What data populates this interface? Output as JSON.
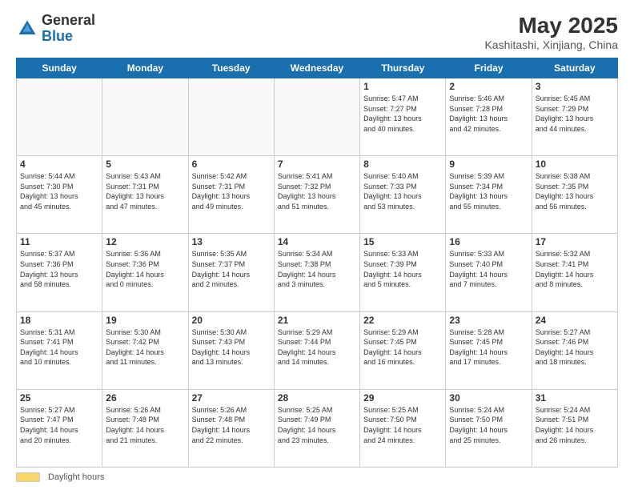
{
  "header": {
    "logo_general": "General",
    "logo_blue": "Blue",
    "month_title": "May 2025",
    "location": "Kashitashi, Xinjiang, China"
  },
  "footer": {
    "label": "Daylight hours"
  },
  "days_of_week": [
    "Sunday",
    "Monday",
    "Tuesday",
    "Wednesday",
    "Thursday",
    "Friday",
    "Saturday"
  ],
  "weeks": [
    [
      {
        "day": "",
        "info": ""
      },
      {
        "day": "",
        "info": ""
      },
      {
        "day": "",
        "info": ""
      },
      {
        "day": "",
        "info": ""
      },
      {
        "day": "1",
        "info": "Sunrise: 5:47 AM\nSunset: 7:27 PM\nDaylight: 13 hours\nand 40 minutes."
      },
      {
        "day": "2",
        "info": "Sunrise: 5:46 AM\nSunset: 7:28 PM\nDaylight: 13 hours\nand 42 minutes."
      },
      {
        "day": "3",
        "info": "Sunrise: 5:45 AM\nSunset: 7:29 PM\nDaylight: 13 hours\nand 44 minutes."
      }
    ],
    [
      {
        "day": "4",
        "info": "Sunrise: 5:44 AM\nSunset: 7:30 PM\nDaylight: 13 hours\nand 45 minutes."
      },
      {
        "day": "5",
        "info": "Sunrise: 5:43 AM\nSunset: 7:31 PM\nDaylight: 13 hours\nand 47 minutes."
      },
      {
        "day": "6",
        "info": "Sunrise: 5:42 AM\nSunset: 7:31 PM\nDaylight: 13 hours\nand 49 minutes."
      },
      {
        "day": "7",
        "info": "Sunrise: 5:41 AM\nSunset: 7:32 PM\nDaylight: 13 hours\nand 51 minutes."
      },
      {
        "day": "8",
        "info": "Sunrise: 5:40 AM\nSunset: 7:33 PM\nDaylight: 13 hours\nand 53 minutes."
      },
      {
        "day": "9",
        "info": "Sunrise: 5:39 AM\nSunset: 7:34 PM\nDaylight: 13 hours\nand 55 minutes."
      },
      {
        "day": "10",
        "info": "Sunrise: 5:38 AM\nSunset: 7:35 PM\nDaylight: 13 hours\nand 56 minutes."
      }
    ],
    [
      {
        "day": "11",
        "info": "Sunrise: 5:37 AM\nSunset: 7:36 PM\nDaylight: 13 hours\nand 58 minutes."
      },
      {
        "day": "12",
        "info": "Sunrise: 5:36 AM\nSunset: 7:36 PM\nDaylight: 14 hours\nand 0 minutes."
      },
      {
        "day": "13",
        "info": "Sunrise: 5:35 AM\nSunset: 7:37 PM\nDaylight: 14 hours\nand 2 minutes."
      },
      {
        "day": "14",
        "info": "Sunrise: 5:34 AM\nSunset: 7:38 PM\nDaylight: 14 hours\nand 3 minutes."
      },
      {
        "day": "15",
        "info": "Sunrise: 5:33 AM\nSunset: 7:39 PM\nDaylight: 14 hours\nand 5 minutes."
      },
      {
        "day": "16",
        "info": "Sunrise: 5:33 AM\nSunset: 7:40 PM\nDaylight: 14 hours\nand 7 minutes."
      },
      {
        "day": "17",
        "info": "Sunrise: 5:32 AM\nSunset: 7:41 PM\nDaylight: 14 hours\nand 8 minutes."
      }
    ],
    [
      {
        "day": "18",
        "info": "Sunrise: 5:31 AM\nSunset: 7:41 PM\nDaylight: 14 hours\nand 10 minutes."
      },
      {
        "day": "19",
        "info": "Sunrise: 5:30 AM\nSunset: 7:42 PM\nDaylight: 14 hours\nand 11 minutes."
      },
      {
        "day": "20",
        "info": "Sunrise: 5:30 AM\nSunset: 7:43 PM\nDaylight: 14 hours\nand 13 minutes."
      },
      {
        "day": "21",
        "info": "Sunrise: 5:29 AM\nSunset: 7:44 PM\nDaylight: 14 hours\nand 14 minutes."
      },
      {
        "day": "22",
        "info": "Sunrise: 5:29 AM\nSunset: 7:45 PM\nDaylight: 14 hours\nand 16 minutes."
      },
      {
        "day": "23",
        "info": "Sunrise: 5:28 AM\nSunset: 7:45 PM\nDaylight: 14 hours\nand 17 minutes."
      },
      {
        "day": "24",
        "info": "Sunrise: 5:27 AM\nSunset: 7:46 PM\nDaylight: 14 hours\nand 18 minutes."
      }
    ],
    [
      {
        "day": "25",
        "info": "Sunrise: 5:27 AM\nSunset: 7:47 PM\nDaylight: 14 hours\nand 20 minutes."
      },
      {
        "day": "26",
        "info": "Sunrise: 5:26 AM\nSunset: 7:48 PM\nDaylight: 14 hours\nand 21 minutes."
      },
      {
        "day": "27",
        "info": "Sunrise: 5:26 AM\nSunset: 7:48 PM\nDaylight: 14 hours\nand 22 minutes."
      },
      {
        "day": "28",
        "info": "Sunrise: 5:25 AM\nSunset: 7:49 PM\nDaylight: 14 hours\nand 23 minutes."
      },
      {
        "day": "29",
        "info": "Sunrise: 5:25 AM\nSunset: 7:50 PM\nDaylight: 14 hours\nand 24 minutes."
      },
      {
        "day": "30",
        "info": "Sunrise: 5:24 AM\nSunset: 7:50 PM\nDaylight: 14 hours\nand 25 minutes."
      },
      {
        "day": "31",
        "info": "Sunrise: 5:24 AM\nSunset: 7:51 PM\nDaylight: 14 hours\nand 26 minutes."
      }
    ]
  ]
}
